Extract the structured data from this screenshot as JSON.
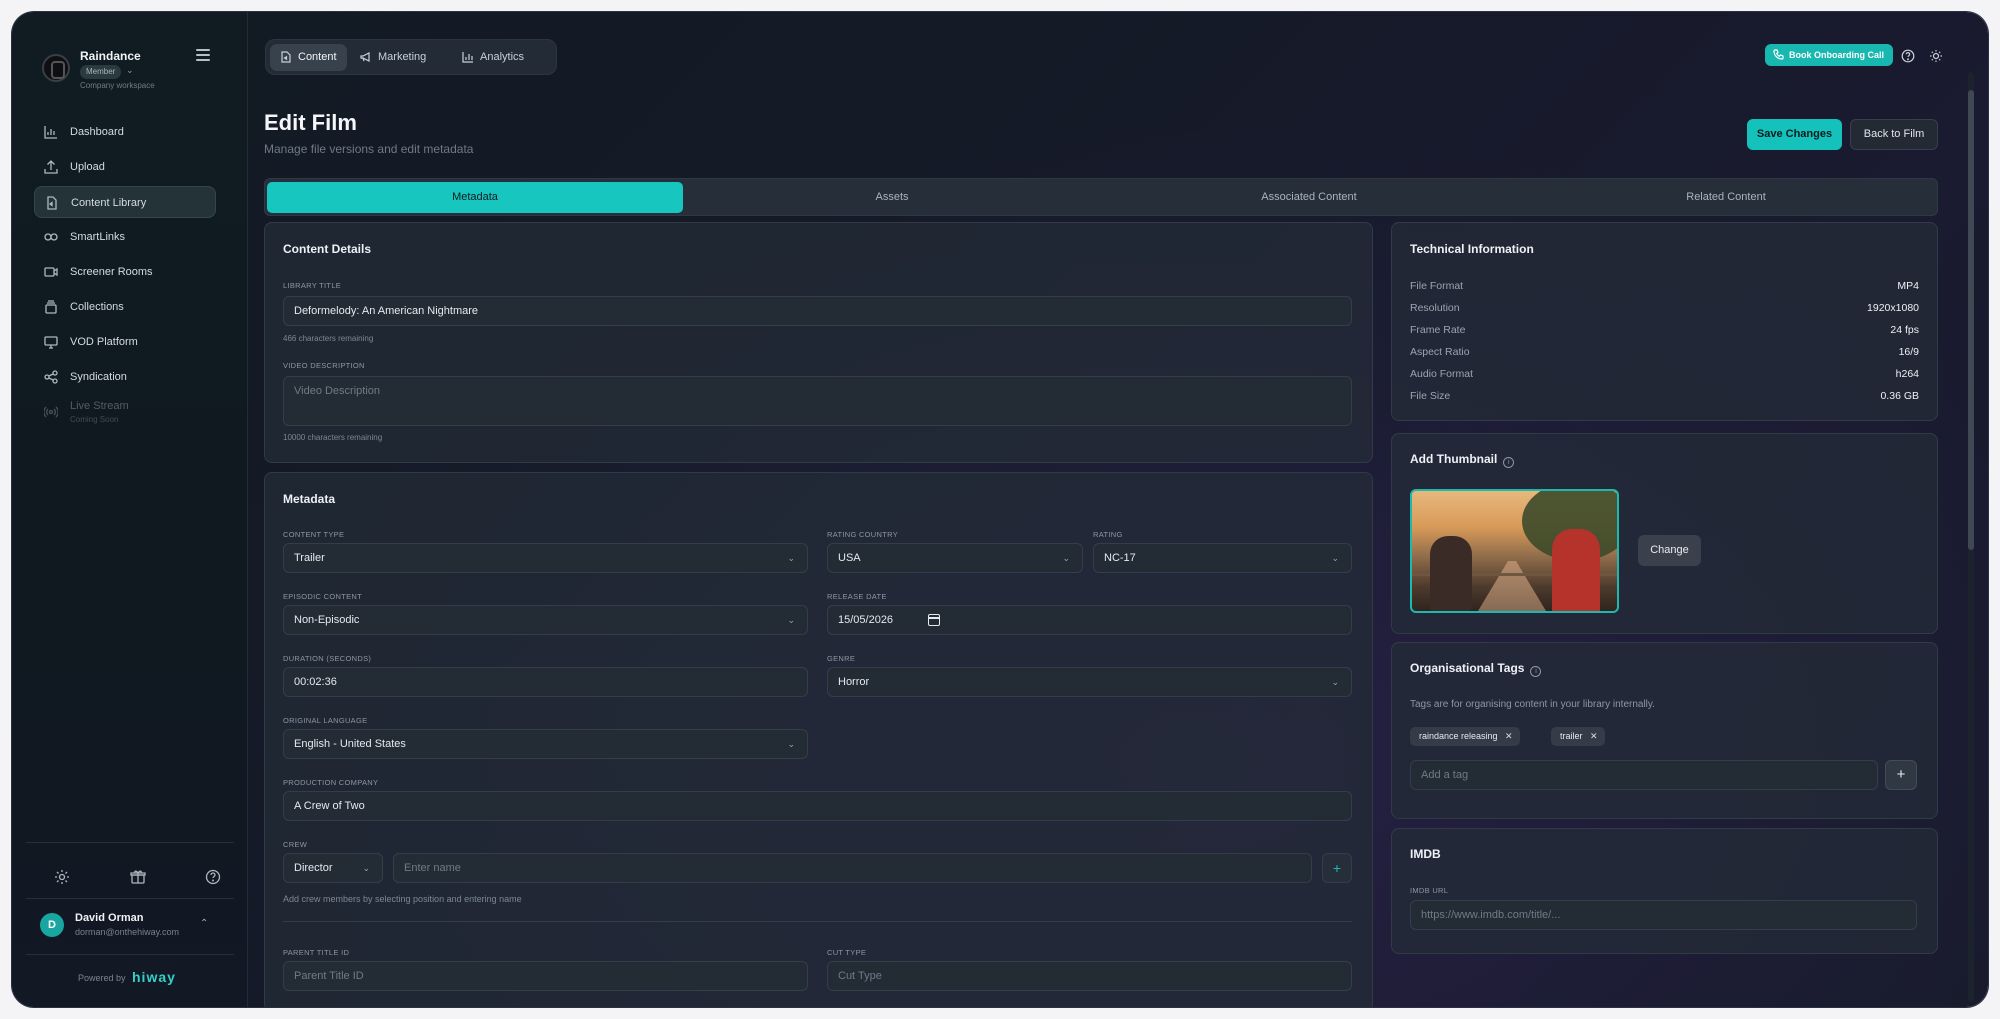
{
  "workspace": {
    "name": "Raindance",
    "role": "Member",
    "subtitle": "Company workspace"
  },
  "sidebar": {
    "items": [
      {
        "label": "Dashboard",
        "icon": "chart-bar-icon"
      },
      {
        "label": "Upload",
        "icon": "upload-icon"
      },
      {
        "label": "Content Library",
        "icon": "file-icon",
        "active": true
      },
      {
        "label": "SmartLinks",
        "icon": "link-icon"
      },
      {
        "label": "Screener Rooms",
        "icon": "video-camera-icon"
      },
      {
        "label": "Collections",
        "icon": "stack-icon"
      },
      {
        "label": "VOD Platform",
        "icon": "monitor-icon"
      },
      {
        "label": "Syndication",
        "icon": "share-icon"
      },
      {
        "label": "Live Stream",
        "sublabel": "Coming Soon",
        "icon": "broadcast-icon",
        "disabled": true
      }
    ]
  },
  "user": {
    "initial": "D",
    "name": "David Orman",
    "email": "dorman@onthehiway.com"
  },
  "footer": {
    "powered_by": "Powered by",
    "brand": "hiway"
  },
  "topnav": {
    "items": [
      "Content",
      "Marketing",
      "Analytics"
    ],
    "active": "Content",
    "onboarding_label": "Book Onboarding Call"
  },
  "page": {
    "title": "Edit Film",
    "subtitle": "Manage file versions and edit metadata",
    "save_label": "Save Changes",
    "back_label": "Back to Film"
  },
  "tabs": [
    "Metadata",
    "Assets",
    "Associated Content",
    "Related Content"
  ],
  "content_details": {
    "title": "Content Details",
    "library_title_label": "LIBRARY TITLE",
    "library_title_value": "Deformelody: An American Nightmare",
    "library_title_hint": "466 characters remaining",
    "description_label": "VIDEO DESCRIPTION",
    "description_placeholder": "Video Description",
    "description_hint": "10000 characters remaining"
  },
  "metadata": {
    "title": "Metadata",
    "content_type_label": "CONTENT TYPE",
    "content_type_value": "Trailer",
    "rating_country_label": "RATING COUNTRY",
    "rating_country_value": "USA",
    "rating_label": "RATING",
    "rating_value": "NC-17",
    "episodic_label": "EPISODIC CONTENT",
    "episodic_value": "Non-Episodic",
    "release_date_label": "RELEASE DATE",
    "release_date_value": "15/05/2026",
    "duration_label": "DURATION (SECONDS)",
    "duration_value": "00:02:36",
    "genre_label": "GENRE",
    "genre_value": "Horror",
    "language_label": "ORIGINAL LANGUAGE",
    "language_value": "English - United States",
    "production_label": "PRODUCTION COMPANY",
    "production_value": "A Crew of Two",
    "crew_label": "CREW",
    "crew_role_value": "Director",
    "crew_name_placeholder": "Enter name",
    "crew_hint": "Add crew members by selecting position and entering name",
    "parent_id_label": "PARENT TITLE ID",
    "parent_id_placeholder": "Parent Title ID",
    "cut_type_label": "CUT TYPE",
    "cut_type_placeholder": "Cut Type"
  },
  "technical": {
    "title": "Technical Information",
    "rows": [
      {
        "key": "File Format",
        "value": "MP4"
      },
      {
        "key": "Resolution",
        "value": "1920x1080"
      },
      {
        "key": "Frame Rate",
        "value": "24 fps"
      },
      {
        "key": "Aspect Ratio",
        "value": "16/9"
      },
      {
        "key": "Audio Format",
        "value": "h264"
      },
      {
        "key": "File Size",
        "value": "0.36 GB"
      }
    ]
  },
  "thumbnail": {
    "title": "Add Thumbnail",
    "change_label": "Change"
  },
  "tags": {
    "title": "Organisational Tags",
    "description": "Tags are for organising content in your library internally.",
    "items": [
      "raindance releasing",
      "trailer"
    ],
    "input_placeholder": "Add a tag"
  },
  "imdb": {
    "title": "IMDB",
    "url_label": "IMDB URL",
    "url_placeholder": "https://www.imdb.com/title/..."
  },
  "colors": {
    "accent": "#17c6be",
    "background": "#141a26",
    "card": "#242c38"
  }
}
